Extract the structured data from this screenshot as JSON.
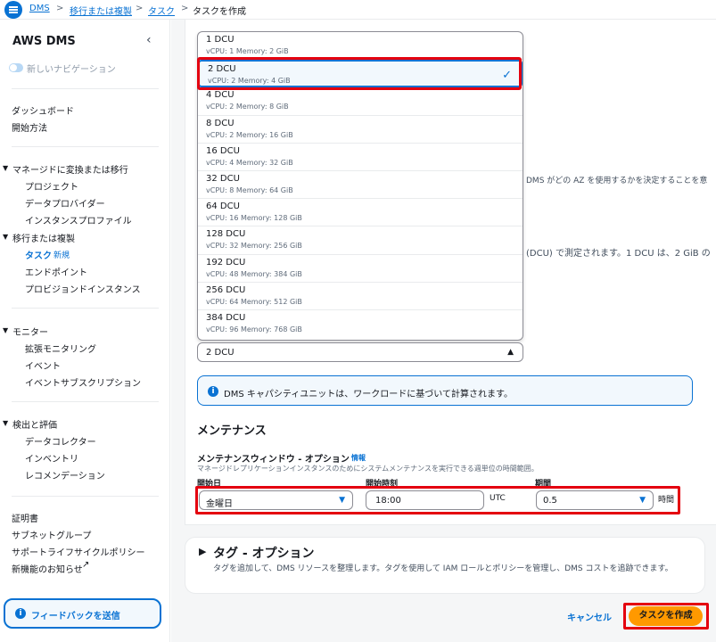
{
  "breadcrumb": {
    "items": [
      "DMS",
      "移行または複製",
      "タスク",
      "タスクを作成"
    ],
    "separator": ">"
  },
  "sidebar": {
    "title": "AWS DMS",
    "collapse_icon": "chevron-left-icon",
    "new_nav_label": "新しいナビゲーション",
    "top_links": [
      "ダッシュボード",
      "開始方法"
    ],
    "group1": {
      "label": "マネージドに変換または移行",
      "items": [
        "プロジェクト",
        "データプロバイダー",
        "インスタンスプロファイル"
      ]
    },
    "group2": {
      "label": "移行または複製",
      "active_item": "タスク",
      "active_badge": "新規",
      "items": [
        "エンドポイント",
        "プロビジョンドインスタンス"
      ]
    },
    "group3": {
      "label": "モニター",
      "items": [
        "拡張モニタリング",
        "イベント",
        "イベントサブスクリプション"
      ]
    },
    "group4": {
      "label": "検出と評価",
      "items": [
        "データコレクター",
        "インベントリ",
        "レコメンデーション"
      ]
    },
    "bottom_links": [
      "証明書",
      "サブネットグループ",
      "サポートライフサイクルポリシー",
      "新機能のお知らせ"
    ],
    "feedback_label": "フィードバックを送信"
  },
  "dcu_options": [
    {
      "label": "1 DCU",
      "detail": "vCPU: 1    Memory: 2 GiB"
    },
    {
      "label": "2 DCU",
      "detail": "vCPU: 2    Memory: 4 GiB"
    },
    {
      "label": "4 DCU",
      "detail": "vCPU: 2    Memory: 8 GiB"
    },
    {
      "label": "8 DCU",
      "detail": "vCPU: 2    Memory: 16 GiB"
    },
    {
      "label": "16 DCU",
      "detail": "vCPU: 4    Memory: 32 GiB"
    },
    {
      "label": "32 DCU",
      "detail": "vCPU: 8    Memory: 64 GiB"
    },
    {
      "label": "64 DCU",
      "detail": "vCPU: 16    Memory: 128 GiB"
    },
    {
      "label": "128 DCU",
      "detail": "vCPU: 32    Memory: 256 GiB"
    },
    {
      "label": "192 DCU",
      "detail": "vCPU: 48    Memory: 384 GiB"
    },
    {
      "label": "256 DCU",
      "detail": "vCPU: 64    Memory: 512 GiB"
    },
    {
      "label": "384 DCU",
      "detail": "vCPU: 96    Memory: 768 GiB"
    }
  ],
  "dcu_select": {
    "value": "2 DCU"
  },
  "background_text": {
    "az_text": "DMS がどの AZ を使用するかを決定することを意",
    "dcu_text": "(DCU) で測定されます。1 DCU は、2 GiB の"
  },
  "info_box": {
    "text": "DMS キャパシティユニットは、ワークロードに基づいて計算されます。"
  },
  "maintenance": {
    "heading": "メンテナンス",
    "window_label": "メンテナンスウィンドウ - オプション",
    "info_link": "情報",
    "description": "マネージドレプリケーションインスタンスのためにシステムメンテナンスを実行できる週単位の時間範囲。",
    "start_day_label": "開始日",
    "start_day_value": "金曜日",
    "start_time_label": "開始時刻",
    "start_time_value": "18:00",
    "utc_label": "UTC",
    "period_label": "期間",
    "period_value": "0.5",
    "hours_label": "時間"
  },
  "tags": {
    "heading": "タグ - オプション",
    "description": "タグを追加して、DMS リソースを整理します。タグを使用して IAM ロールとポリシーを管理し、DMS コストを追跡できます。"
  },
  "actions": {
    "cancel": "キャンセル",
    "create": "タスクを作成"
  },
  "colors": {
    "accent": "#0972d3",
    "highlight": "#e4000f",
    "primary_button": "#ff9900"
  }
}
